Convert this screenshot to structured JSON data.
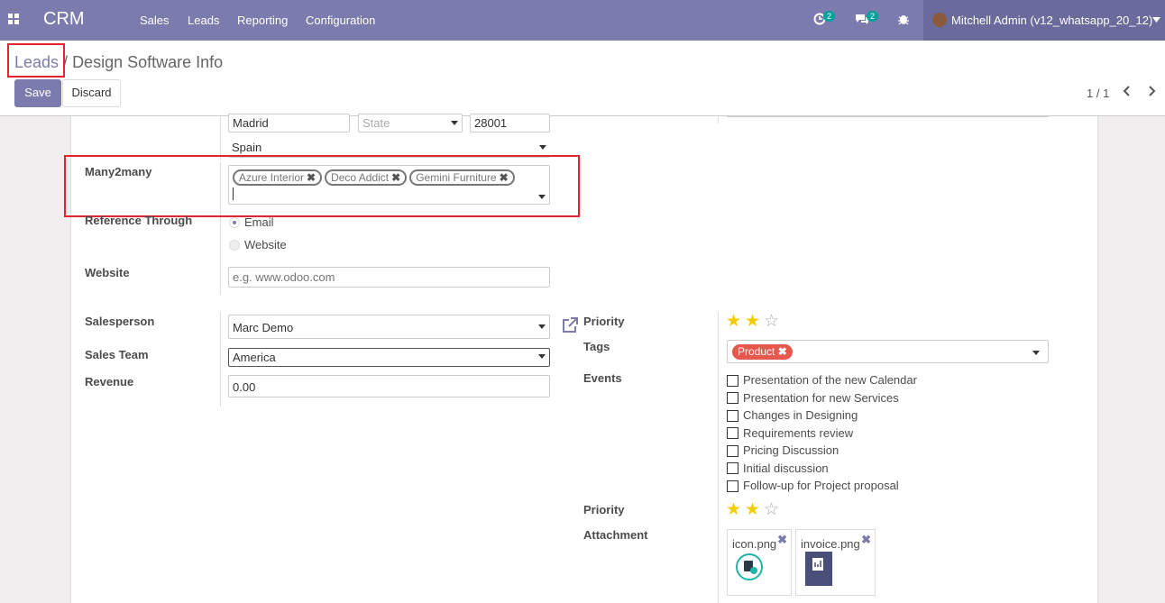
{
  "navbar": {
    "brand": "CRM",
    "menu": [
      "Sales",
      "Leads",
      "Reporting",
      "Configuration"
    ],
    "activity_badge": "2",
    "messages_badge": "2",
    "user_name": "Mitchell Admin (v12_whatsapp_20_12)"
  },
  "breadcrumb": {
    "parent": "Leads",
    "separator": " / ",
    "current": "Design Software Info"
  },
  "buttons": {
    "save": "Save",
    "discard": "Discard"
  },
  "pager": {
    "text": "1 / 1"
  },
  "address": {
    "city": "Madrid",
    "state_placeholder": "State",
    "zip": "28001",
    "country": "Spain"
  },
  "many2many": {
    "label": "Many2many",
    "tags": [
      "Azure Interior",
      "Deco Addict",
      "Gemini Furniture"
    ]
  },
  "reference": {
    "label": "Reference Through",
    "options": [
      "Email",
      "Website"
    ],
    "selected": "Email"
  },
  "website": {
    "label": "Website",
    "placeholder": "e.g. www.odoo.com"
  },
  "salesperson": {
    "label": "Salesperson",
    "value": "Marc Demo"
  },
  "sales_team": {
    "label": "Sales Team",
    "value": "America"
  },
  "revenue": {
    "label": "Revenue",
    "value": "0.00"
  },
  "priority": {
    "label": "Priority",
    "stars_on": 2,
    "stars_total": 3
  },
  "tags": {
    "label": "Tags",
    "values": [
      "Product"
    ],
    "color": "#e6574e"
  },
  "events": {
    "label": "Events",
    "items": [
      "Presentation of the new Calendar",
      "Presentation for new Services",
      "Changes in Designing",
      "Requirements review",
      "Pricing Discussion",
      "Initial discussion",
      "Follow-up for Project proposal"
    ]
  },
  "priority2": {
    "label": "Priority"
  },
  "attachment": {
    "label": "Attachment",
    "files": [
      "icon.png",
      "invoice.png"
    ]
  },
  "colors": {
    "brand": "#7c7bad",
    "highlight": "#e4242e",
    "star": "#f3cc00"
  }
}
